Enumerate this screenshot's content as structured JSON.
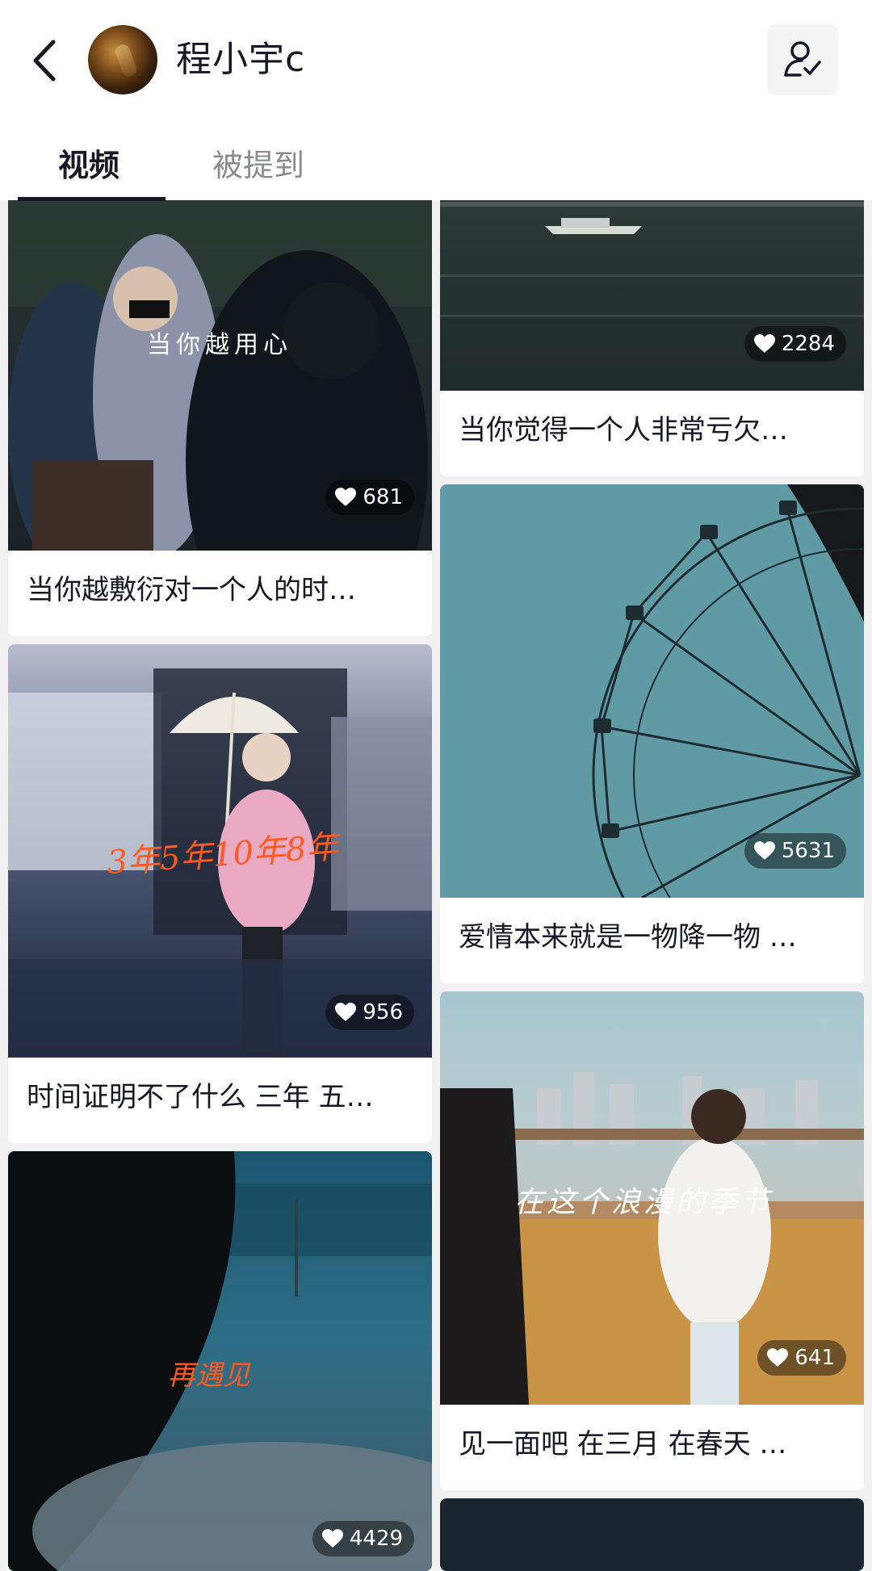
{
  "header": {
    "username": "程小宇c",
    "back_icon": "chevron-left-icon",
    "follow_icon": "user-check-icon"
  },
  "tabs": [
    {
      "label": "视频",
      "active": true
    },
    {
      "label": "被提到",
      "active": false
    }
  ],
  "videos": [
    {
      "caption": "当你越敷衍对一个人的时…",
      "likes": "681",
      "overlay": "当你越用心"
    },
    {
      "caption": "时间证明不了什么 三年 五…",
      "likes": "956",
      "overlay": "3年5年10年8年"
    },
    {
      "caption": "",
      "likes": "4429",
      "overlay": "再遇见"
    },
    {
      "caption": "当你觉得一个人非常亏欠…",
      "likes": "2284",
      "overlay": ""
    },
    {
      "caption": "爱情本来就是一物降一物 …",
      "likes": "5631",
      "overlay": ""
    },
    {
      "caption": "见一面吧 在三月 在春天 …",
      "likes": "641",
      "overlay": "在这个浪漫的季节"
    }
  ],
  "colors": {
    "background": "#f1f1f1",
    "card": "#ffffff",
    "text_primary": "#161823",
    "text_secondary": "#8a8b91",
    "overlay_orange": "#ff5a1f"
  }
}
